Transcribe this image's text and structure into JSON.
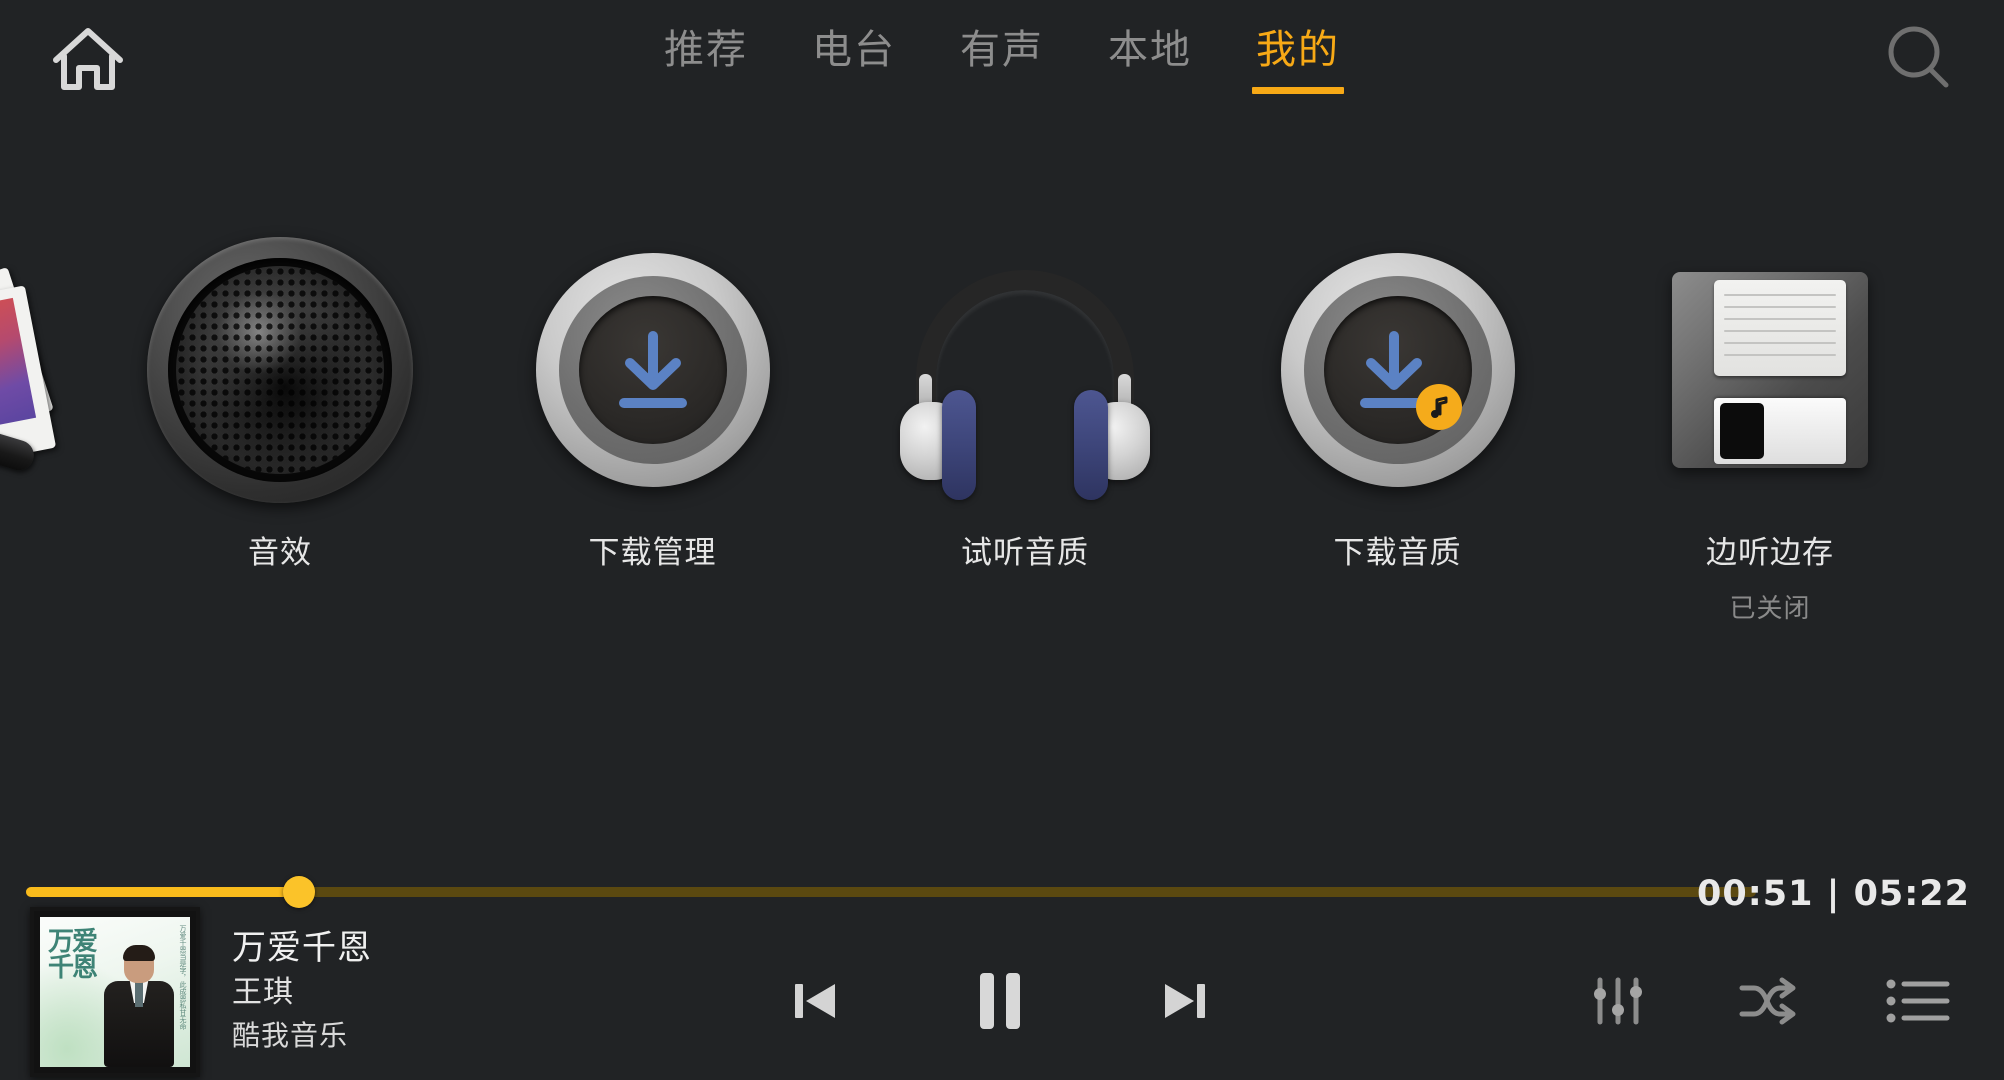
{
  "topbar": {
    "home_icon": "home-icon",
    "search_icon": "search-icon",
    "tabs": [
      {
        "label": "推荐",
        "active": false
      },
      {
        "label": "电台",
        "active": false
      },
      {
        "label": "有声",
        "active": false
      },
      {
        "label": "本地",
        "active": false
      },
      {
        "label": "我的",
        "active": true
      }
    ]
  },
  "features": [
    {
      "label": "音效",
      "sub": "",
      "icon": "speaker-icon"
    },
    {
      "label": "下载管理",
      "sub": "",
      "icon": "download-circle-icon"
    },
    {
      "label": "试听音质",
      "sub": "",
      "icon": "headphones-icon"
    },
    {
      "label": "下载音质",
      "sub": "",
      "icon": "download-music-circle-icon"
    },
    {
      "label": "边听边存",
      "sub": "已关闭",
      "icon": "floppy-disk-icon"
    }
  ],
  "player": {
    "progress": {
      "current_time": "00:51",
      "total_time": "05:22",
      "time_display": "00:51 | 05:22",
      "percent": 15.8
    },
    "song": {
      "title": "万爱千恩",
      "artist": "王琪",
      "source": "酷我音乐",
      "cover_text": "万爱千恩",
      "cover_side_text": "万爱千恩当是字，此成恩私甘无命"
    },
    "transport": [
      {
        "name": "previous-button",
        "icon": "skip-previous-icon"
      },
      {
        "name": "play-pause-button",
        "icon": "pause-icon"
      },
      {
        "name": "next-button",
        "icon": "skip-next-icon"
      }
    ],
    "right_controls": [
      {
        "name": "equalizer-button",
        "icon": "equalizer-icon"
      },
      {
        "name": "shuffle-button",
        "icon": "shuffle-icon"
      },
      {
        "name": "playlist-button",
        "icon": "playlist-icon"
      }
    ]
  },
  "colors": {
    "background": "#212325",
    "accent": "#f7a916",
    "progress_fill": "#f9bb1c",
    "progress_track": "#5b4910",
    "tab_inactive": "#8d8d8d",
    "download_arrow_blue": "#5b82c4",
    "badge_orange": "#f5ab1b"
  }
}
